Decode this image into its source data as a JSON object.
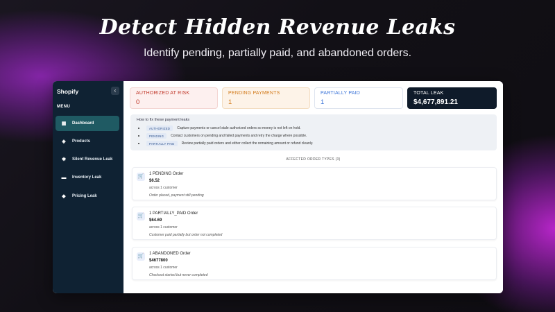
{
  "promo": {
    "headline": "Detect Hidden Revenue Leaks",
    "subhead": "Identify pending, partially paid, and abandoned orders."
  },
  "sidebar": {
    "brand": "Shopify",
    "collapse_icon": "‹",
    "menu_label": "MENU",
    "items": [
      {
        "label": "Dashboard",
        "icon": "grid-icon",
        "glyph": "▦",
        "active": true
      },
      {
        "label": "Products",
        "icon": "tag-icon",
        "glyph": "◈",
        "active": false
      },
      {
        "label": "Silent Revenue Leak",
        "icon": "bug-icon",
        "glyph": "✱",
        "active": false
      },
      {
        "label": "Inventory Leak",
        "icon": "truck-icon",
        "glyph": "▬",
        "active": false
      },
      {
        "label": "Pricing Leak",
        "icon": "price-tag-icon",
        "glyph": "◆",
        "active": false
      }
    ]
  },
  "stats": [
    {
      "label": "AUTHORIZED AT RISK",
      "value": "0",
      "color": "#c0392b"
    },
    {
      "label": "PENDING PAYMENTS",
      "value": "1",
      "color": "#d27b1c"
    },
    {
      "label": "PARTIALLY PAID",
      "value": "1",
      "color": "#3a73d8"
    },
    {
      "label": "TOTAL LEAK",
      "value": "$4,677,891.21",
      "color": "#0f1b2a"
    }
  ],
  "fix": {
    "title": "How to fix these payment leaks",
    "rows": [
      {
        "badge": "AUTHORIZED",
        "text": "Capture payments or cancel stale authorized orders so money is not left on hold."
      },
      {
        "badge": "PENDING",
        "text": "Contact customers on pending and failed payments and retry the charge where possible."
      },
      {
        "badge": "PARTIALLY PAID",
        "text": "Review partially paid orders and either collect the remaining amount or refund cleanly."
      }
    ]
  },
  "affected_label": "AFFECTED ORDER TYPES (3)",
  "orders": [
    {
      "title": "1 PENDING Order",
      "amount": "$6.52",
      "sub": "across 1 customer",
      "note": "Order placed, payment still pending",
      "icon": "cart-icon"
    },
    {
      "title": "1 PARTIALLY_PAID Order",
      "amount": "$64.69",
      "sub": "across 1 customer",
      "note": "Customer paid partially but order not completed",
      "icon": "cart-icon"
    },
    {
      "title": "1 ABANDONED Order",
      "amount": "$4677800",
      "sub": "across 1 customer",
      "note": "Checkout started but never completed",
      "icon": "cart-icon"
    }
  ],
  "colors": {
    "sidebar_bg": "#0f2233",
    "active_item": "#1f5a63",
    "accent_blue": "#3a73d8"
  }
}
